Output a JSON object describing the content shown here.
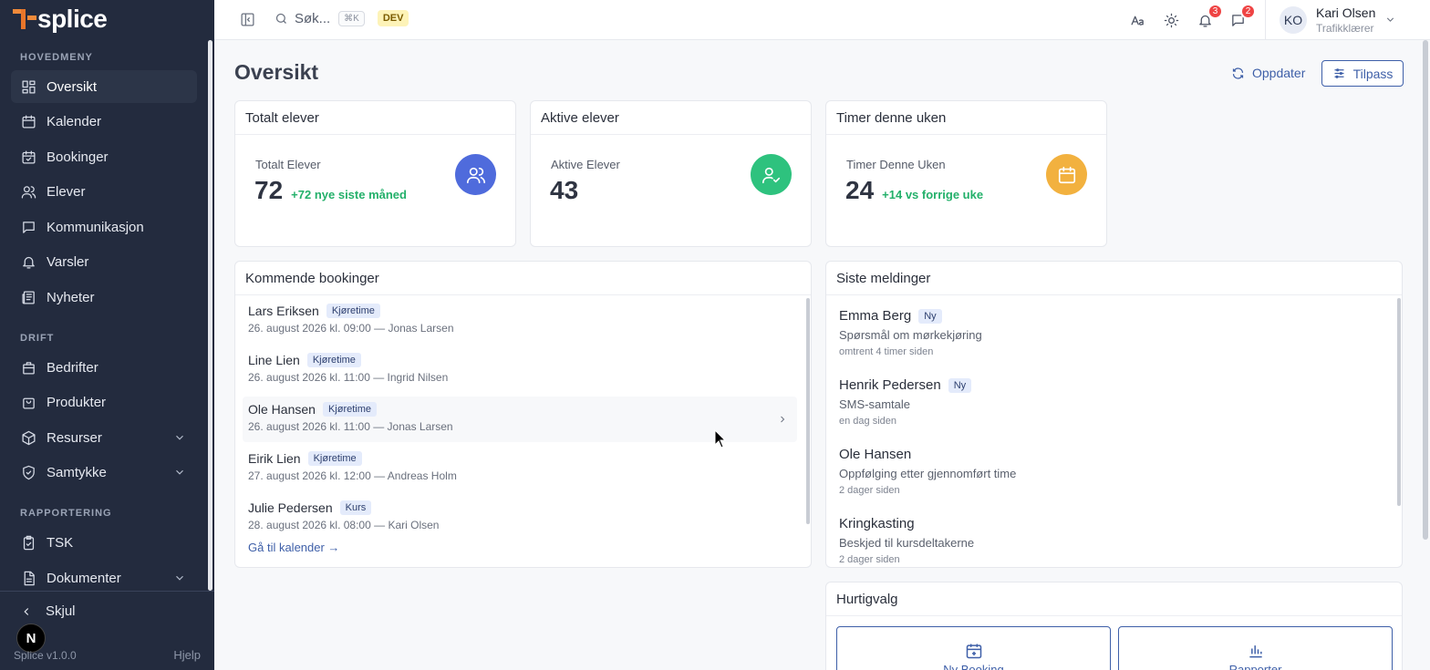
{
  "app": {
    "logo_text": "splice",
    "version": "Splice v1.0.0",
    "help": "Hjelp",
    "collapse": "Skjul",
    "next_badge": "N"
  },
  "sidebar": {
    "sections": [
      "HOVEDMENY",
      "DRIFT",
      "RAPPORTERING"
    ],
    "items": [
      {
        "label": "Oversikt",
        "icon": "grid-icon"
      },
      {
        "label": "Kalender",
        "icon": "calendar-icon"
      },
      {
        "label": "Bookinger",
        "icon": "calendar-check-icon"
      },
      {
        "label": "Elever",
        "icon": "users-icon"
      },
      {
        "label": "Kommunikasjon",
        "icon": "message-icon"
      },
      {
        "label": "Varsler",
        "icon": "bell-icon"
      },
      {
        "label": "Nyheter",
        "icon": "newspaper-icon"
      },
      {
        "label": "Bedrifter",
        "icon": "building-icon"
      },
      {
        "label": "Produkter",
        "icon": "shopping-bag-icon"
      },
      {
        "label": "Resurser",
        "icon": "package-icon"
      },
      {
        "label": "Samtykke",
        "icon": "shield-check-icon"
      },
      {
        "label": "TSK",
        "icon": "clipboard-icon"
      },
      {
        "label": "Dokumenter",
        "icon": "document-icon"
      }
    ]
  },
  "topbar": {
    "search_placeholder": "Søk...",
    "shortcut": "⌘K",
    "env_badge": "DEV",
    "notifications_count": "3",
    "messages_count": "2",
    "user": {
      "initials": "KO",
      "name": "Kari Olsen",
      "role": "Trafikklærer"
    }
  },
  "main": {
    "title": "Oversikt",
    "refresh_label": "Oppdater",
    "customize_label": "Tilpass",
    "stats": [
      {
        "title": "Totalt elever",
        "label": "Totalt Elever",
        "value": "72",
        "delta": "+72 nye siste måned",
        "color": "#4f6bdc",
        "icon": "users-icon"
      },
      {
        "title": "Aktive elever",
        "label": "Aktive Elever",
        "value": "43",
        "delta": "",
        "color": "#2ec27e",
        "icon": "user-check-icon"
      },
      {
        "title": "Timer denne uken",
        "label": "Timer Denne Uken",
        "value": "24",
        "delta": "+14 vs forrige uke",
        "color": "#f2b13f",
        "icon": "calendar-icon"
      }
    ],
    "bookings": {
      "title": "Kommende bookinger",
      "items": [
        {
          "name": "Lars Eriksen",
          "tag": "Kjøretime",
          "time": "26. august 2026 kl. 09:00 — Jonas Larsen"
        },
        {
          "name": "Line Lien",
          "tag": "Kjøretime",
          "time": "26. august 2026 kl. 11:00 — Ingrid Nilsen"
        },
        {
          "name": "Ole Hansen",
          "tag": "Kjøretime",
          "time": "26. august 2026 kl. 11:00 — Jonas Larsen"
        },
        {
          "name": "Eirik Lien",
          "tag": "Kjøretime",
          "time": "27. august 2026 kl. 12:00 — Andreas Holm"
        },
        {
          "name": "Julie Pedersen",
          "tag": "Kurs",
          "time": "28. august 2026 kl. 08:00 — Kari Olsen"
        }
      ],
      "link": "Gå til kalender →"
    },
    "messages": {
      "title": "Siste meldinger",
      "items": [
        {
          "name": "Emma Berg",
          "tag": "Ny",
          "text": "Spørsmål om mørkekjøring",
          "time": "omtrent 4 timer siden"
        },
        {
          "name": "Henrik Pedersen",
          "tag": "Ny",
          "text": "SMS-samtale",
          "time": "en dag siden"
        },
        {
          "name": "Ole Hansen",
          "tag": "",
          "text": "Oppfølging etter gjennomført time",
          "time": "2 dager siden"
        },
        {
          "name": "Kringkasting",
          "tag": "",
          "text": "Beskjed til kursdeltakerne",
          "time": "2 dager siden"
        }
      ]
    },
    "quick": {
      "title": "Hurtigvalg",
      "buttons": [
        {
          "label": "Ny Booking",
          "icon": "calendar-plus-icon"
        },
        {
          "label": "Rapporter",
          "icon": "bar-chart-icon"
        }
      ]
    }
  }
}
